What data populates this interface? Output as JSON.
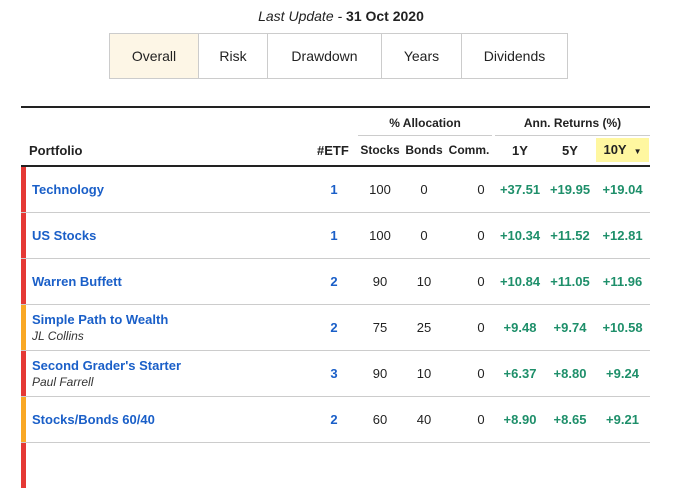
{
  "update": {
    "label": "Last Update - ",
    "date": "31 Oct 2020"
  },
  "tabs": [
    "Overall",
    "Risk",
    "Drawdown",
    "Years",
    "Dividends"
  ],
  "table": {
    "headers": {
      "portfolio": "Portfolio",
      "etf": "#ETF",
      "allocation_group": "% Allocation",
      "returns_group": "Ann. Returns (%)",
      "stocks": "Stocks",
      "bonds": "Bonds",
      "comm": "Comm.",
      "r1y": "1Y",
      "r5y": "5Y",
      "r10y": "10Y",
      "sort_indicator": "▼"
    },
    "rows": [
      {
        "name": "Technology",
        "author": "",
        "etf": "1",
        "stocks": "100",
        "bonds": "0",
        "comm": "0",
        "r1y": "+37.51",
        "r5y": "+19.95",
        "r10y": "+19.04",
        "bar_color": "#e53935"
      },
      {
        "name": "US Stocks",
        "author": "",
        "etf": "1",
        "stocks": "100",
        "bonds": "0",
        "comm": "0",
        "r1y": "+10.34",
        "r5y": "+11.52",
        "r10y": "+12.81",
        "bar_color": "#e53935"
      },
      {
        "name": "Warren Buffett",
        "author": "",
        "etf": "2",
        "stocks": "90",
        "bonds": "10",
        "comm": "0",
        "r1y": "+10.84",
        "r5y": "+11.05",
        "r10y": "+11.96",
        "bar_color": "#e53935"
      },
      {
        "name": "Simple Path to Wealth",
        "author": "JL Collins",
        "etf": "2",
        "stocks": "75",
        "bonds": "25",
        "comm": "0",
        "r1y": "+9.48",
        "r5y": "+9.74",
        "r10y": "+10.58",
        "bar_color": "#f9a825"
      },
      {
        "name": "Second Grader's Starter",
        "author": "Paul Farrell",
        "etf": "3",
        "stocks": "90",
        "bonds": "10",
        "comm": "0",
        "r1y": "+6.37",
        "r5y": "+8.80",
        "r10y": "+9.24",
        "bar_color": "#e53935"
      },
      {
        "name": "Stocks/Bonds 60/40",
        "author": "",
        "etf": "2",
        "stocks": "60",
        "bonds": "40",
        "comm": "0",
        "r1y": "+8.90",
        "r5y": "+8.65",
        "r10y": "+9.21",
        "bar_color": "#f9a825"
      },
      {
        "name": "",
        "author": "",
        "etf": "",
        "stocks": "",
        "bonds": "",
        "comm": "",
        "r1y": "",
        "r5y": "",
        "r10y": "",
        "bar_color": "#e53935"
      }
    ]
  },
  "colors": {
    "link": "#1a5fc8",
    "positive": "#1e8f6a",
    "sort_highlight": "#fff7a0",
    "active_tab": "#fdf6e6"
  }
}
